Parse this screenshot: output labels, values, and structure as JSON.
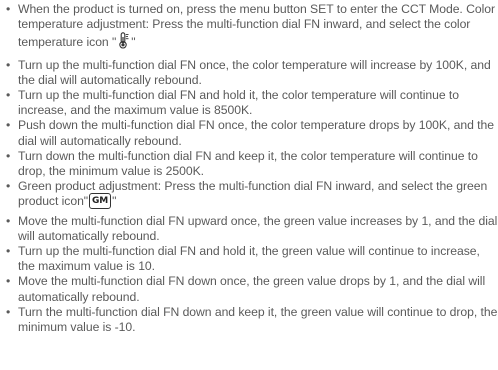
{
  "items": [
    {
      "text": "When the product is turned on, press the menu button SET to enter the CCT Mode. Color temperature adjustment: Press the multi-function dial FN inward, and select the color temperature icon \"",
      "icon": "thermometer-icon",
      "suffix": "\""
    },
    {
      "text": "Turn up the multi-function dial FN once, the color temperature will increase by 100K, and the dial will automatically rebound."
    },
    {
      "text": "Turn up the multi-function dial FN and hold it, the color temperature will continue to increase, and the maximum value is 8500K."
    },
    {
      "text": "Push down the multi-function dial FN once, the color temperature drops by 100K, and the dial will automatically rebound."
    },
    {
      "text": "Turn down the multi-function dial FN and keep it, the color temperature will continue to drop, the minimum value is 2500K."
    },
    {
      "text": "Green product adjustment: Press the multi-function dial FN inward, and select the green product icon\"",
      "icon": "gm-icon",
      "icon_label": "GM",
      "suffix": "\""
    },
    {
      "text": "Move the multi-function dial FN upward once, the green value increases by 1, and the dial will automatically rebound."
    },
    {
      "text": "Turn up the multi-function dial FN and hold it, the green value will continue to increase, the maximum value is 10."
    },
    {
      "text": "Move the multi-function dial FN down once, the green value drops by 1, and the dial will automatically rebound."
    },
    {
      "text": "Turn the multi-function dial FN down and keep it, the green value will continue to drop, the minimum value is -10."
    }
  ]
}
